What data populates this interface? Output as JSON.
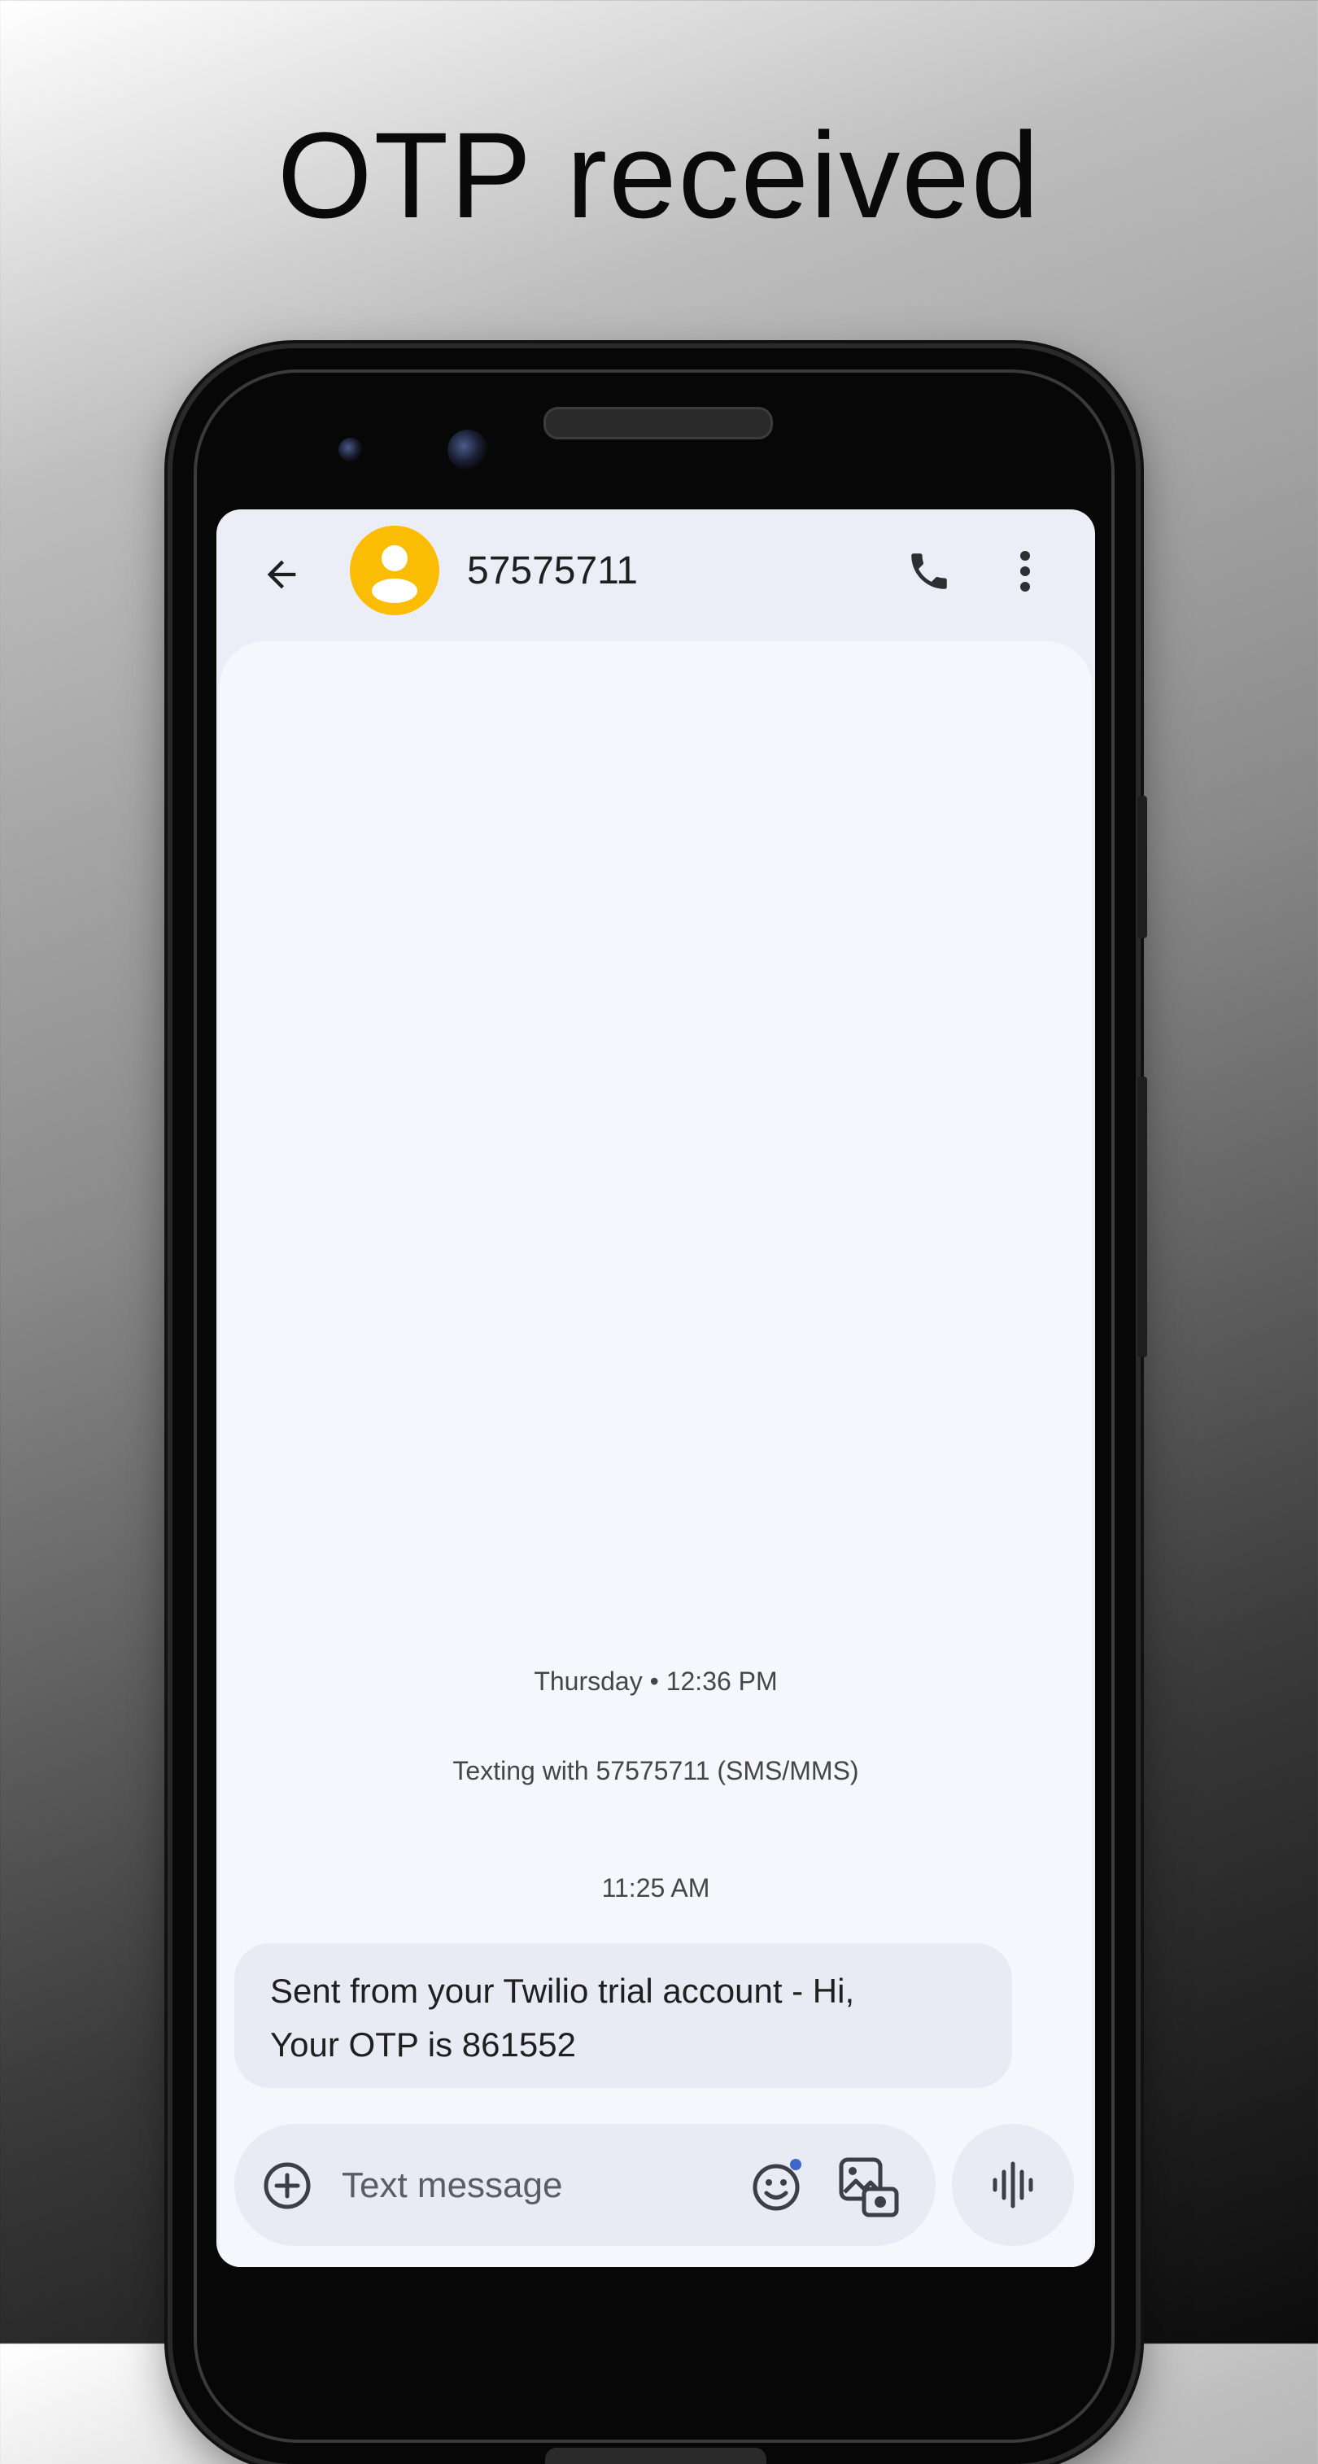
{
  "headline": "OTP received",
  "conversation": {
    "contact_name": "57575711",
    "date_label": "Thursday • 12:36 PM",
    "texting_label": "Texting with 57575711 (SMS/MMS)",
    "time_label": "11:25 AM",
    "message_lines": [
      "Sent from your Twilio trial account - Hi,",
      "Your OTP is 861552"
    ]
  },
  "composer": {
    "placeholder": "Text message"
  },
  "icons": {
    "back": "arrow-back-icon",
    "avatar": "person-icon",
    "call": "phone-icon",
    "more": "more-vert-icon",
    "add": "add-circle-icon",
    "emoji": "emoji-icon",
    "gallery": "gallery-icon",
    "voice": "voice-waveform-icon"
  },
  "colors": {
    "avatar_bg": "#fbbc04",
    "screen_bg": "#f6f7fd",
    "bubble_bg": "#e8eaf4"
  }
}
